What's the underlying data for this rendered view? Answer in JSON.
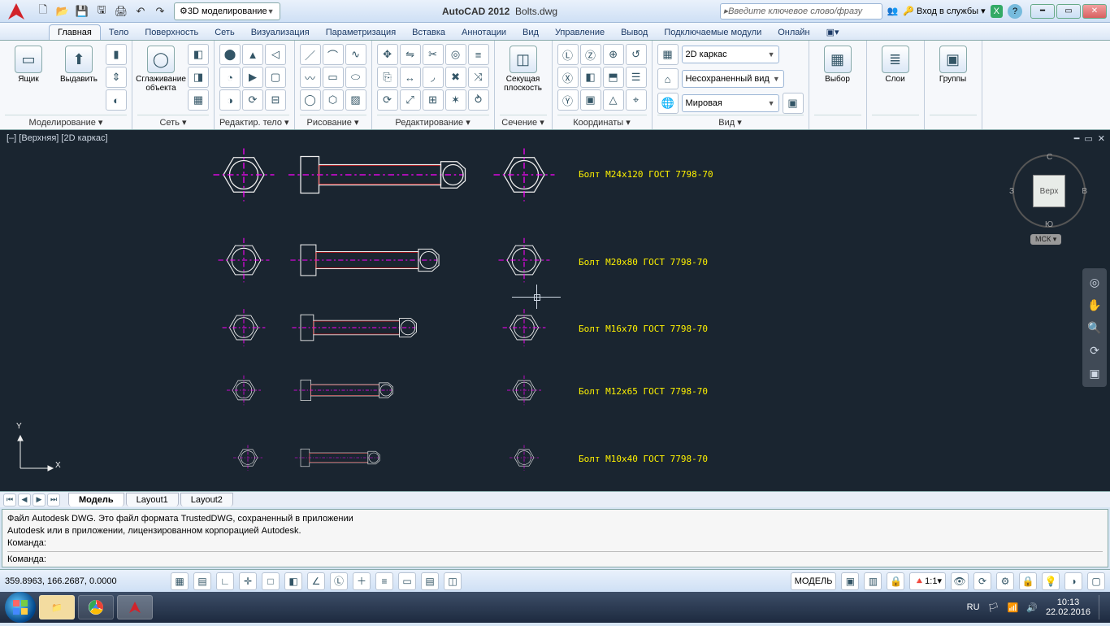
{
  "app": {
    "name": "AutoCAD 2012",
    "file": "Bolts.dwg"
  },
  "workspace": "3D моделирование",
  "search_placeholder": "Введите ключевое слово/фразу",
  "signin": "Вход в службы",
  "tabs": [
    "Главная",
    "Тело",
    "Поверхность",
    "Сеть",
    "Визуализация",
    "Параметризация",
    "Вставка",
    "Аннотации",
    "Вид",
    "Управление",
    "Вывод",
    "Подключаемые модули",
    "Онлайн"
  ],
  "active_tab": 0,
  "panels": {
    "modeling": {
      "title": "Моделирование ▾",
      "box": "Ящик",
      "extrude": "Выдавить"
    },
    "mesh": {
      "title": "Сеть ▾",
      "smooth": "Сглаживание\nобъекта"
    },
    "solidedit": {
      "title": "Редактир. тело ▾"
    },
    "draw": {
      "title": "Рисование ▾"
    },
    "modify": {
      "title": "Редактирование ▾"
    },
    "section": {
      "title": "Сечение ▾",
      "plane": "Секущая\nплоскость"
    },
    "coords": {
      "title": "Координаты ▾"
    },
    "view": {
      "title": "Вид ▾",
      "style": "2D каркас",
      "saved": "Несохраненный вид",
      "ucs": "Мировая"
    },
    "sel": {
      "title": " ",
      "pick": "Выбор"
    },
    "layers": {
      "title": " ",
      "lay": "Слои"
    },
    "groups": {
      "title": " ",
      "grp": "Группы"
    }
  },
  "viewport_label": "[–] [Верхняя] [2D каркас]",
  "viewcube": {
    "face": "Верх",
    "n": "С",
    "s": "Ю",
    "e": "В",
    "w": "З",
    "msk": "МСК"
  },
  "bolts": [
    {
      "label": "Болт M24x120 ГОСТ 7798-70"
    },
    {
      "label": "Болт M20x80 ГОСТ 7798-70"
    },
    {
      "label": "Болт M16x70 ГОСТ 7798-70"
    },
    {
      "label": "Болт M12x65 ГОСТ 7798-70"
    },
    {
      "label": "Болт M10x40 ГОСТ 7798-70"
    }
  ],
  "layout_tabs": [
    "Модель",
    "Layout1",
    "Layout2"
  ],
  "active_layout": 0,
  "cmd_history": "Файл Autodesk DWG. Это файл формата TrustedDWG, сохраненный в приложении\nAutodesk или в приложении, лицензированном корпорацией Autodesk.\nКоманда:",
  "cmd_prompt": "Команда:",
  "status": {
    "coords": "359.8963, 166.2687, 0.0000",
    "space": "МОДЕЛЬ",
    "annoscale": "1:1"
  },
  "tray": {
    "lang": "RU",
    "time": "10:13",
    "date": "22.02.2016"
  }
}
